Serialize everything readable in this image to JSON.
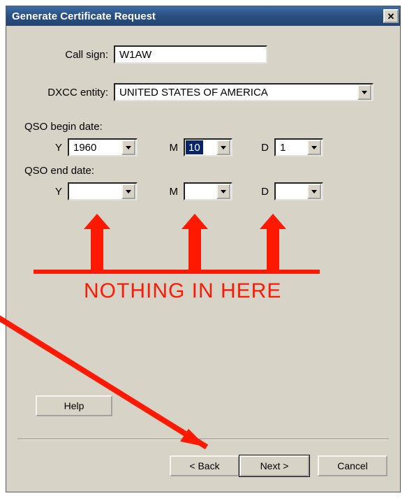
{
  "window": {
    "title": "Generate Certificate Request"
  },
  "fields": {
    "callsign_label": "Call sign:",
    "callsign_value": "W1AW",
    "dxcc_label": "DXCC entity:",
    "dxcc_value": "UNITED STATES OF AMERICA"
  },
  "qso": {
    "begin_label": "QSO begin date:",
    "end_label": "QSO end date:",
    "y_short": "Y",
    "m_short": "M",
    "d_short": "D",
    "begin": {
      "y": "1960",
      "m": "10",
      "d": "1"
    },
    "end": {
      "y": "",
      "m": "",
      "d": ""
    }
  },
  "buttons": {
    "help": "Help",
    "back": "< Back",
    "next": "Next >",
    "cancel": "Cancel"
  },
  "annotation": {
    "text": "NOTHING IN HERE",
    "color": "#fe1a02"
  }
}
